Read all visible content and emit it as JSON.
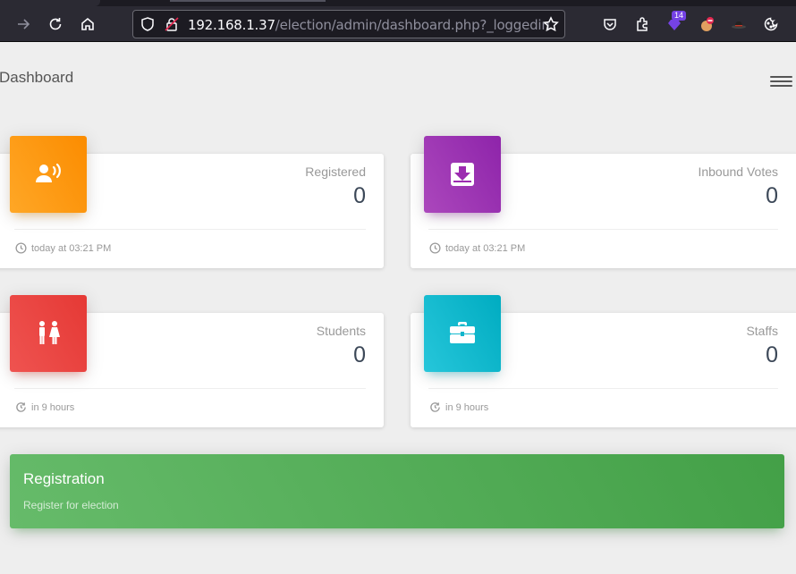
{
  "browser": {
    "url_host": "192.168.1.37",
    "url_path": "/election/admin/dashboard.php?_loggedin",
    "extension_badge": "14"
  },
  "page": {
    "title": "Dashboard"
  },
  "cards": [
    {
      "label": "Registered",
      "value": "0",
      "footer": "today at 03:21 PM",
      "icon": "speaker-person-icon",
      "color": "#fb8c00"
    },
    {
      "label": "Inbound Votes",
      "value": "0",
      "footer": "today at 03:21 PM",
      "icon": "inbox-download-icon",
      "color": "#8e24aa"
    },
    {
      "label": "Students",
      "value": "0",
      "footer": "in 9 hours",
      "icon": "male-female-icon",
      "color": "#e53935"
    },
    {
      "label": "Staffs",
      "value": "0",
      "footer": "in 9 hours",
      "icon": "briefcase-icon",
      "color": "#00acc1"
    }
  ],
  "registration": {
    "title": "Registration",
    "subtitle": "Register for election",
    "color": "#43a047"
  }
}
